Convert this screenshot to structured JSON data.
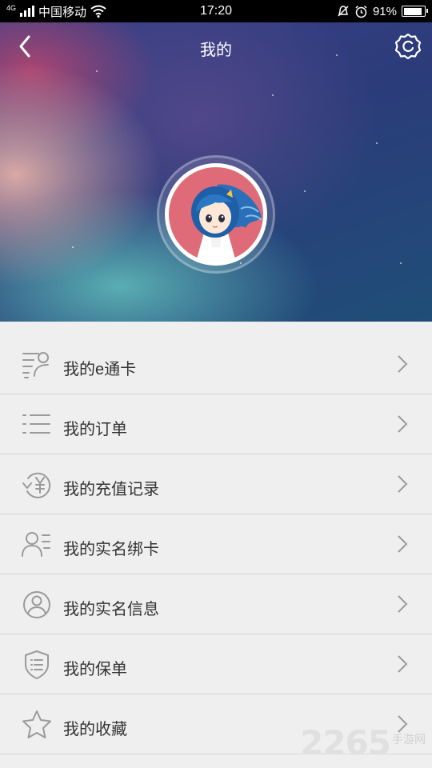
{
  "status_bar": {
    "carrier": "中国移动",
    "time": "17:20",
    "battery": "91%",
    "network": "4G"
  },
  "header": {
    "title": "我的"
  },
  "menu": [
    {
      "label": "我的e通卡",
      "icon": "card-icon"
    },
    {
      "label": "我的订单",
      "icon": "list-icon"
    },
    {
      "label": "我的充值记录",
      "icon": "recharge-yuan-icon"
    },
    {
      "label": "我的实名绑卡",
      "icon": "user-card-icon"
    },
    {
      "label": "我的实名信息",
      "icon": "user-circle-icon"
    },
    {
      "label": "我的保单",
      "icon": "shield-icon"
    },
    {
      "label": "我的收藏",
      "icon": "star-icon"
    }
  ],
  "watermark": {
    "number": "2265",
    "text": "手游网"
  },
  "colors": {
    "icon_gray": "#9a9a9a",
    "menu_bg": "#efefef",
    "divider": "#d6d6d6",
    "avatar_bg": "#e06b78"
  }
}
